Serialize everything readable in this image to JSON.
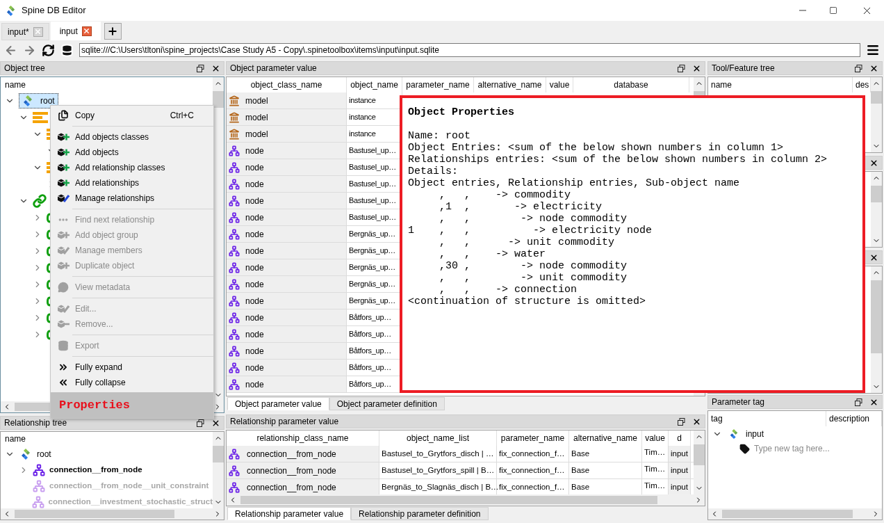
{
  "window": {
    "title": "Spine DB Editor"
  },
  "tabs": [
    {
      "label": "input*",
      "selected": false
    },
    {
      "label": "input",
      "selected": true
    }
  ],
  "url": {
    "value": "sqlite:///C:\\Users\\tltoni\\spine_projects\\Case Study A5 - Copy\\.spinetoolbox\\items\\input\\input.sqlite"
  },
  "object_tree": {
    "title": "Object tree",
    "header": "name",
    "items": [
      {
        "label": "root",
        "kind": "database",
        "selected": true,
        "expanded": true,
        "children": [
          {
            "kind": "class_list",
            "expanded": true,
            "children": [
              {
                "kind": "class_list",
                "expanded": true,
                "children": [
                  {
                    "expanded": true
                  }
                ]
              },
              {
                "kind": "class_list",
                "expanded": true,
                "children": [
                  {
                    "expanded": false
                  }
                ]
              }
            ]
          },
          {
            "kind": "relationship_list",
            "expanded": true,
            "children": [
              {
                "kind": "relationship",
                "expanded": false
              },
              {
                "kind": "relationship",
                "expanded": false
              },
              {
                "kind": "relationship",
                "expanded": false
              },
              {
                "kind": "relationship",
                "expanded": false
              },
              {
                "kind": "relationship",
                "expanded": false
              },
              {
                "kind": "relationship",
                "expanded": false
              },
              {
                "kind": "relationship",
                "expanded": false
              },
              {
                "kind": "relationship",
                "expanded": false
              }
            ]
          }
        ]
      }
    ]
  },
  "relationship_tree": {
    "title": "Relationship tree",
    "header": "name",
    "root": {
      "label": "root",
      "expanded": true
    },
    "items": [
      {
        "label": "connection__from_node",
        "populated": true,
        "expanded": false
      },
      {
        "label": "connection__from_node__unit_constraint",
        "populated": false
      },
      {
        "label": "connection__investment_stochastic_struct",
        "populated": false
      }
    ]
  },
  "object_parameter_value": {
    "title": "Object parameter value",
    "columns": [
      "object_class_name",
      "object_name",
      "parameter_name",
      "alternative_name",
      "value",
      "database"
    ],
    "rows": [
      {
        "kind": "model",
        "object_class_name": "model",
        "object_name": "instance"
      },
      {
        "kind": "model",
        "object_class_name": "model",
        "object_name": "instance"
      },
      {
        "kind": "model",
        "object_class_name": "model",
        "object_name": "instance"
      },
      {
        "kind": "node",
        "object_class_name": "node",
        "object_name": "Bastusel_up…"
      },
      {
        "kind": "node",
        "object_class_name": "node",
        "object_name": "Bastusel_up…"
      },
      {
        "kind": "node",
        "object_class_name": "node",
        "object_name": "Bastusel_up…"
      },
      {
        "kind": "node",
        "object_class_name": "node",
        "object_name": "Bastusel_up…"
      },
      {
        "kind": "node",
        "object_class_name": "node",
        "object_name": "Bastusel_up…"
      },
      {
        "kind": "node",
        "object_class_name": "node",
        "object_name": "Bergnäs_up…"
      },
      {
        "kind": "node",
        "object_class_name": "node",
        "object_name": "Bergnäs_up…"
      },
      {
        "kind": "node",
        "object_class_name": "node",
        "object_name": "Bergnäs_up…"
      },
      {
        "kind": "node",
        "object_class_name": "node",
        "object_name": "Bergnäs_up…"
      },
      {
        "kind": "node",
        "object_class_name": "node",
        "object_name": "Bergnäs_up…"
      },
      {
        "kind": "node",
        "object_class_name": "node",
        "object_name": "Båtfors_up…"
      },
      {
        "kind": "node",
        "object_class_name": "node",
        "object_name": "Båtfors_up…"
      },
      {
        "kind": "node",
        "object_class_name": "node",
        "object_name": "Båtfors_up…"
      },
      {
        "kind": "node",
        "object_class_name": "node",
        "object_name": "Båtfors_up…"
      },
      {
        "kind": "node",
        "object_class_name": "node",
        "object_name": "Båtfors_up…"
      }
    ],
    "tabs": [
      {
        "label": "Object parameter value",
        "selected": true
      },
      {
        "label": "Object parameter definition",
        "selected": false
      }
    ]
  },
  "relationship_parameter_value": {
    "title": "Relationship parameter value",
    "columns": [
      "relationship_class_name",
      "object_name_list",
      "parameter_name",
      "alternative_name",
      "value",
      "d"
    ],
    "rows": [
      {
        "relationship_class_name": "connection__from_node",
        "object_name_list": "Bastusel_to_Grytfors_disch | …",
        "parameter_name": "fix_connection_f…",
        "alternative_name": "Base",
        "value": "Tim…",
        "database": "input"
      },
      {
        "relationship_class_name": "connection__from_node",
        "object_name_list": "Bastusel_to_Grytfors_spill | B…",
        "parameter_name": "fix_connection_f…",
        "alternative_name": "Base",
        "value": "Tim…",
        "database": "input"
      },
      {
        "relationship_class_name": "connection__from_node",
        "object_name_list": "Bergnäs_to_Slagnäs_disch | B…",
        "parameter_name": "fix_connection_f…",
        "alternative_name": "Base",
        "value": "Tim…",
        "database": "input"
      }
    ],
    "tabs": [
      {
        "label": "Relationship parameter value",
        "selected": true
      },
      {
        "label": "Relationship parameter definition",
        "selected": false
      }
    ]
  },
  "tool_feature_tree": {
    "title": "Tool/Feature tree",
    "columns": [
      "name",
      "des"
    ]
  },
  "parameter_tag": {
    "title": "Parameter tag",
    "columns": [
      "tag",
      "description"
    ],
    "root": {
      "label": "input",
      "expanded": true
    },
    "new_tag": {
      "placeholder": "Type new tag here..."
    }
  },
  "context_menu": {
    "groups": [
      {
        "items": [
          {
            "label": "Copy",
            "shortcut": "Ctrl+C",
            "disabled": false
          }
        ]
      },
      {
        "items": [
          {
            "label": "Add objects classes",
            "disabled": false
          },
          {
            "label": "Add objects",
            "disabled": false
          },
          {
            "label": "Add relationship classes",
            "disabled": false
          },
          {
            "label": "Add relationships",
            "disabled": false
          },
          {
            "label": "Manage relationships",
            "disabled": false
          }
        ]
      },
      {
        "items": [
          {
            "label": "Find next relationship",
            "disabled": true
          },
          {
            "label": "Add object group",
            "disabled": true
          },
          {
            "label": "Manage members",
            "disabled": true
          },
          {
            "label": "Duplicate object",
            "disabled": true
          }
        ]
      },
      {
        "items": [
          {
            "label": "View metadata",
            "disabled": true
          }
        ]
      },
      {
        "items": [
          {
            "label": "Edit...",
            "disabled": true
          },
          {
            "label": "Remove...",
            "disabled": true
          }
        ]
      },
      {
        "items": [
          {
            "label": "Export",
            "disabled": true
          }
        ]
      },
      {
        "items": [
          {
            "label": "Fully expand",
            "disabled": false
          },
          {
            "label": "Fully collapse",
            "disabled": false
          }
        ]
      }
    ],
    "footer": {
      "label": "Properties",
      "highlighted": true
    }
  },
  "properties_popup": {
    "title": "Object Properties",
    "lines": [
      "Name: root",
      "Object Entries: <sum of the below shown numbers in column 1>",
      "Relationships entries: <sum of the below shown numbers in column 2>",
      "Details:",
      "Object entries, Relationship entries, Sub-object name",
      "     ,   ,    -> commodity",
      "     ,1  ,       -> electricity",
      "     ,   ,        -> node commodity",
      "1    ,   ,          -> electricity node",
      "     ,   ,      -> unit commodity",
      "     ,   ,    -> water",
      "     ,30 ,        -> node commodity",
      "     ,   ,        -> unit commodity",
      "     ,   ,    -> connection",
      "<continuation of structure is omitted>"
    ]
  }
}
